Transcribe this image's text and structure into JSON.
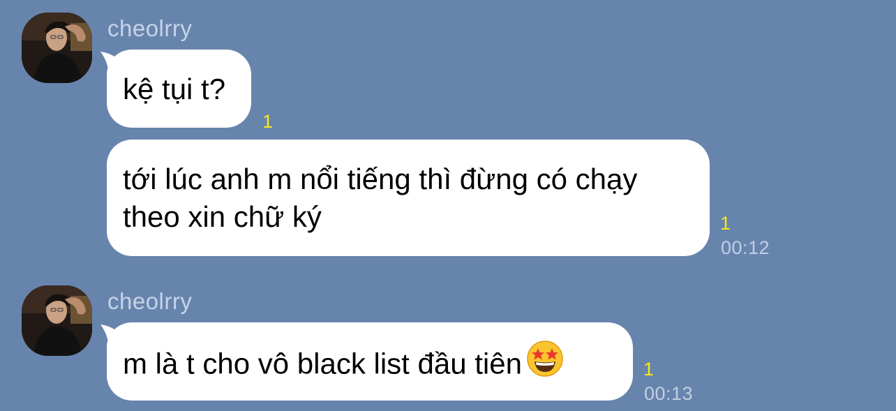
{
  "theme": {
    "background": "#6784ad",
    "bubble": "#ffffff",
    "read_indicator_color": "#f7e81c"
  },
  "messages": [
    {
      "sender": "cheolrry",
      "bubbles": [
        {
          "text": "kệ tụi t?",
          "read_count": "1"
        },
        {
          "lines": [
            "tới lúc anh m nổi tiếng thì đừng có chạy",
            "theo xin chữ ký"
          ],
          "read_count": "1",
          "time": "00:12"
        }
      ]
    },
    {
      "sender": "cheolrry",
      "bubbles": [
        {
          "text": "m là t cho vô black list đầu tiên",
          "emoji": "star-struck-emoji-icon",
          "read_count": "1",
          "time": "00:13"
        }
      ]
    }
  ]
}
